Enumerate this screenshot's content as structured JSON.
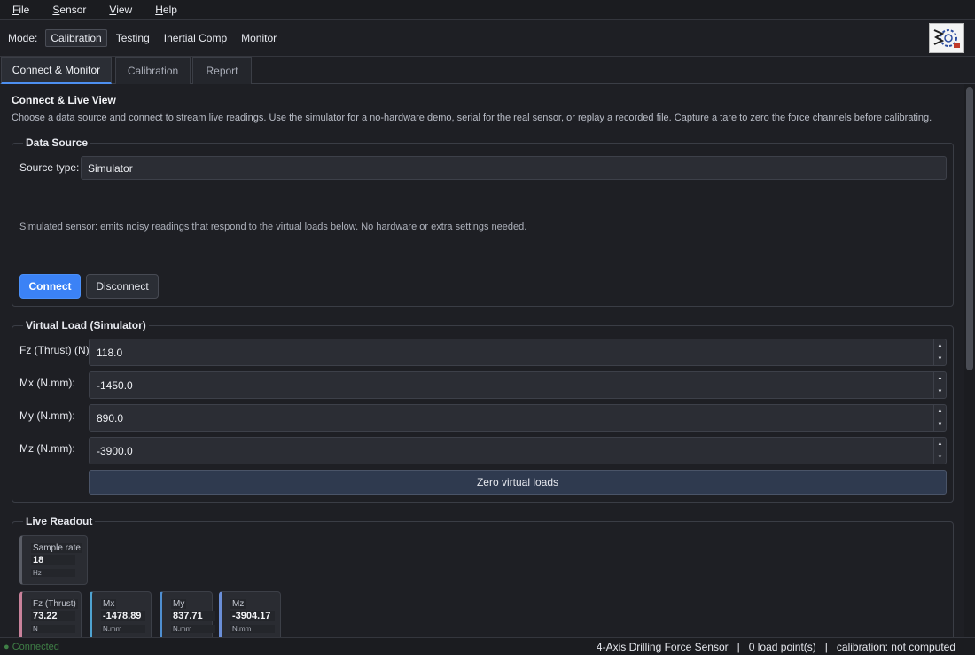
{
  "menubar": {
    "items": [
      {
        "mnemonic": "F",
        "rest": "ile"
      },
      {
        "mnemonic": "S",
        "rest": "ensor"
      },
      {
        "mnemonic": "V",
        "rest": "iew"
      },
      {
        "mnemonic": "H",
        "rest": "elp"
      }
    ]
  },
  "modebar": {
    "label": "Mode:",
    "modes": [
      "Calibration",
      "Testing",
      "Inertial Comp",
      "Monitor"
    ],
    "active": "Calibration"
  },
  "tabs": [
    "Connect & Monitor",
    "Calibration",
    "Report"
  ],
  "page": {
    "title": "Connect & Live View",
    "description": "Choose a data source and connect to stream live readings. Use the simulator for a no-hardware demo, serial for the real sensor, or replay a recorded file. Capture a tare to zero the force channels before calibrating."
  },
  "data_source": {
    "title": "Data Source",
    "source_label": "Source type:",
    "source_value": "Simulator",
    "hint": "Simulated sensor: emits noisy readings that respond to the virtual loads below. No hardware or extra settings needed.",
    "connect_label": "Connect",
    "disconnect_label": "Disconnect"
  },
  "virtual_load": {
    "title": "Virtual Load (Simulator)",
    "fields": [
      {
        "label": "Fz (Thrust) (N):",
        "value": "118.0"
      },
      {
        "label": "Mx (N.mm):",
        "value": "-1450.0"
      },
      {
        "label": "My (N.mm):",
        "value": "890.0"
      },
      {
        "label": "Mz (N.mm):",
        "value": "-3900.0"
      }
    ],
    "zero_label": "Zero virtual loads"
  },
  "live_readout": {
    "title": "Live Readout",
    "sample_rate": {
      "label": "Sample rate",
      "value": "18",
      "unit": "Hz",
      "color": "#5a5d66"
    },
    "channels": [
      {
        "label": "Fz (Thrust)",
        "value": "73.22",
        "unit": "N",
        "color": "#c9829b"
      },
      {
        "label": "Mx",
        "value": "-1478.89",
        "unit": "N.mm",
        "color": "#4fa3d1"
      },
      {
        "label": "My",
        "value": "837.71",
        "unit": "N.mm",
        "color": "#4f8fd1"
      },
      {
        "label": "Mz",
        "value": "-3904.17",
        "unit": "N.mm",
        "color": "#6b8fd8"
      }
    ]
  },
  "status": {
    "connection": "● Connected",
    "summary": "4-Axis Drilling Force Sensor   |   0 load point(s)   |   calibration: not computed"
  },
  "colors": {
    "accent": "#3b82f6",
    "connected": "#3f7f46"
  }
}
